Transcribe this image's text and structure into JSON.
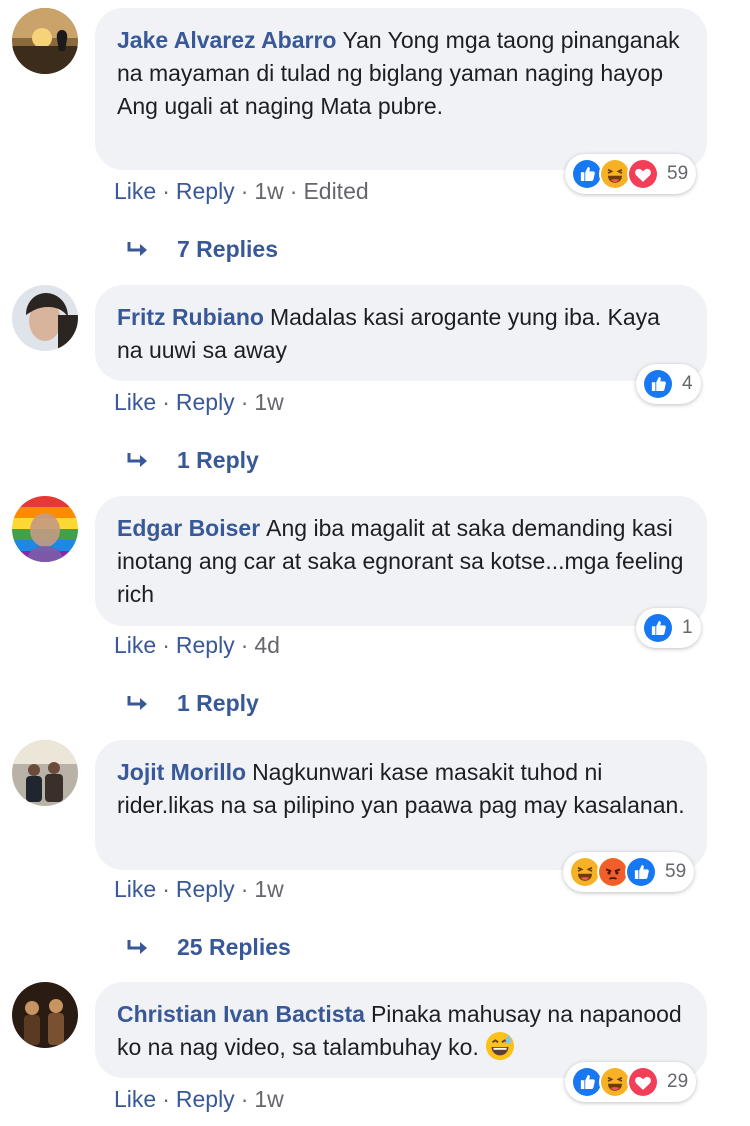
{
  "comments": [
    {
      "author": "Jake Alvarez Abarro",
      "text": "Yan Yong mga taong pinanganak na mayaman di tulad ng biglang yaman naging hayop Ang ugali at naging Mata pubre.",
      "reactions": {
        "icons": [
          "like-icon",
          "haha-icon",
          "love-icon"
        ],
        "count": "59"
      },
      "like": "Like",
      "reply": "Reply",
      "time": "1w",
      "edited": "Edited",
      "replies": "7 Replies"
    },
    {
      "author": "Fritz Rubiano",
      "text": "Madalas kasi arogante yung iba. Kaya na uuwi sa away",
      "reactions": {
        "icons": [
          "like-icon"
        ],
        "count": "4"
      },
      "like": "Like",
      "reply": "Reply",
      "time": "1w",
      "replies": "1 Reply"
    },
    {
      "author": "Edgar Boiser",
      "text": "Ang iba magalit at saka demanding kasi inotang ang car at saka egnorant sa kotse...mga feeling rich",
      "reactions": {
        "icons": [
          "like-icon"
        ],
        "count": "1"
      },
      "like": "Like",
      "reply": "Reply",
      "time": "4d",
      "replies": "1 Reply"
    },
    {
      "author": "Jojit Morillo",
      "text": "Nagkunwari kase masakit tuhod ni rider.likas na sa pilipino yan paawa pag may kasalanan.",
      "reactions": {
        "icons": [
          "haha-icon",
          "angry-icon",
          "like-icon"
        ],
        "count": "59"
      },
      "like": "Like",
      "reply": "Reply",
      "time": "1w",
      "replies": "25 Replies"
    },
    {
      "author": "Christian Ivan Bactista",
      "text": "Pinaka mahusay na napanood ko na nag video, sa talambuhay ko.",
      "emoji": "grinning-sweat-emoji",
      "reactions": {
        "icons": [
          "like-icon",
          "haha-icon",
          "love-icon"
        ],
        "count": "29"
      },
      "like": "Like",
      "reply": "Reply",
      "time": "1w"
    }
  ],
  "colors": {
    "link": "#385898",
    "bubble": "#f0f2f5",
    "meta": "#65676b",
    "like": "#1877f2",
    "love": "#f33e58",
    "haha": "#f7b125",
    "angry": "#e9710f"
  }
}
